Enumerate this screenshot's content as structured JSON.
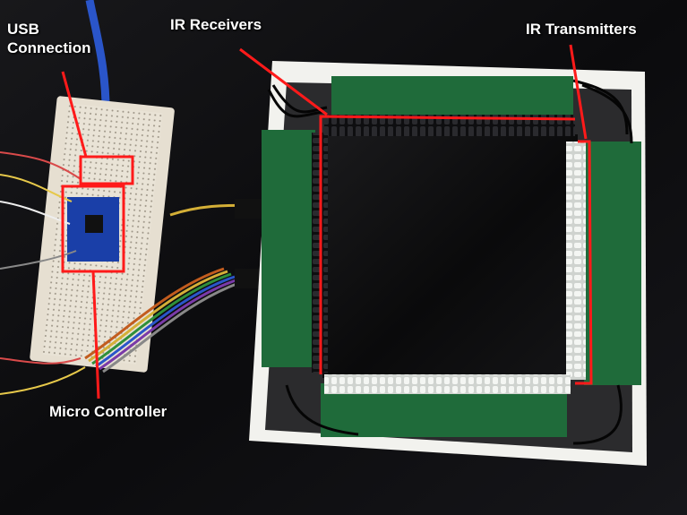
{
  "labels": {
    "usb_line1": "USB",
    "usb_line2": "Connection",
    "ir_receivers": "IR Receivers",
    "ir_transmitters": "IR Transmitters",
    "micro_controller": "Micro Controller"
  },
  "colors": {
    "annotation": "#ff1a1a",
    "pcb": "#1f6b3a",
    "frame": "#f2f2ee",
    "background": "#0d0d0f"
  }
}
